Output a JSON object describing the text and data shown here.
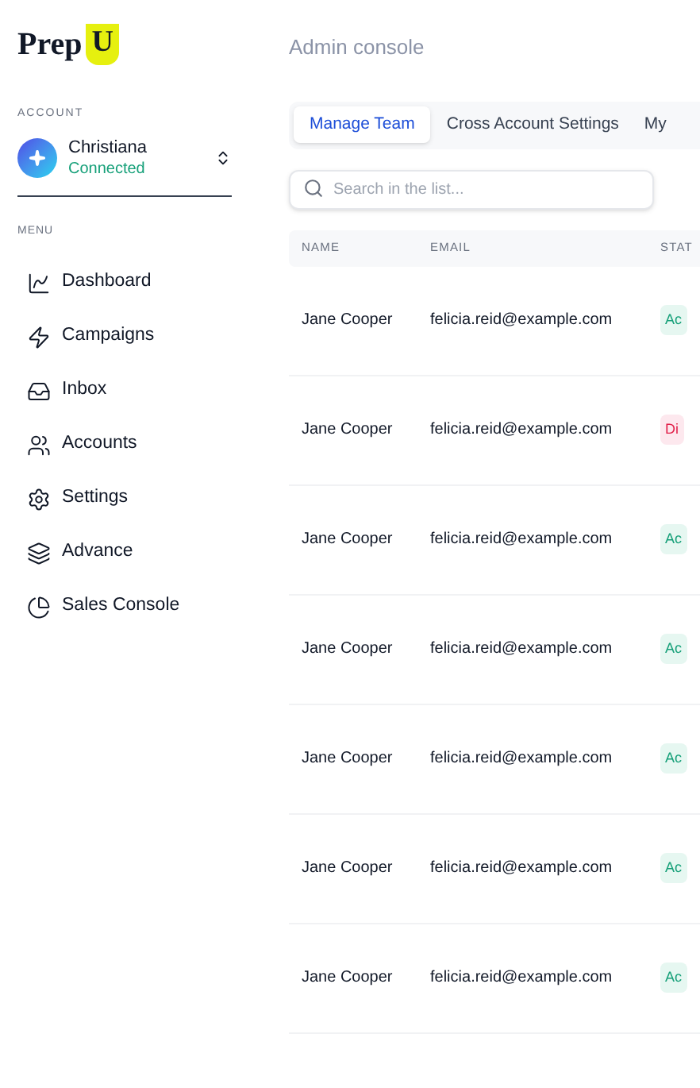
{
  "logo": {
    "text": "Prep",
    "mark": "U"
  },
  "account": {
    "section_label": "ACCOUNT",
    "name": "Christiana",
    "status": "Connected"
  },
  "menu": {
    "section_label": "MENU",
    "items": [
      {
        "label": "Dashboard"
      },
      {
        "label": "Campaigns"
      },
      {
        "label": "Inbox"
      },
      {
        "label": "Accounts"
      },
      {
        "label": "Settings"
      },
      {
        "label": "Advance"
      },
      {
        "label": "Sales Console"
      }
    ]
  },
  "page_title": "Admin console",
  "tabs": [
    {
      "label": "Manage Team",
      "selected": true
    },
    {
      "label": "Cross Account Settings",
      "selected": false
    },
    {
      "label": "My",
      "selected": false
    }
  ],
  "search": {
    "placeholder": "Search in the list..."
  },
  "table": {
    "columns": [
      "NAME",
      "EMAIL",
      "STAT"
    ],
    "rows": [
      {
        "name": "Jane Cooper",
        "email": "felicia.reid@example.com",
        "status": "Ac",
        "kind": "active"
      },
      {
        "name": "Jane Cooper",
        "email": "felicia.reid@example.com",
        "status": "Di",
        "kind": "disabled"
      },
      {
        "name": "Jane Cooper",
        "email": "felicia.reid@example.com",
        "status": "Ac",
        "kind": "active"
      },
      {
        "name": "Jane Cooper",
        "email": "felicia.reid@example.com",
        "status": "Ac",
        "kind": "active"
      },
      {
        "name": "Jane Cooper",
        "email": "felicia.reid@example.com",
        "status": "Ac",
        "kind": "active"
      },
      {
        "name": "Jane Cooper",
        "email": "felicia.reid@example.com",
        "status": "Ac",
        "kind": "active"
      },
      {
        "name": "Jane Cooper",
        "email": "felicia.reid@example.com",
        "status": "Ac",
        "kind": "active"
      }
    ]
  }
}
